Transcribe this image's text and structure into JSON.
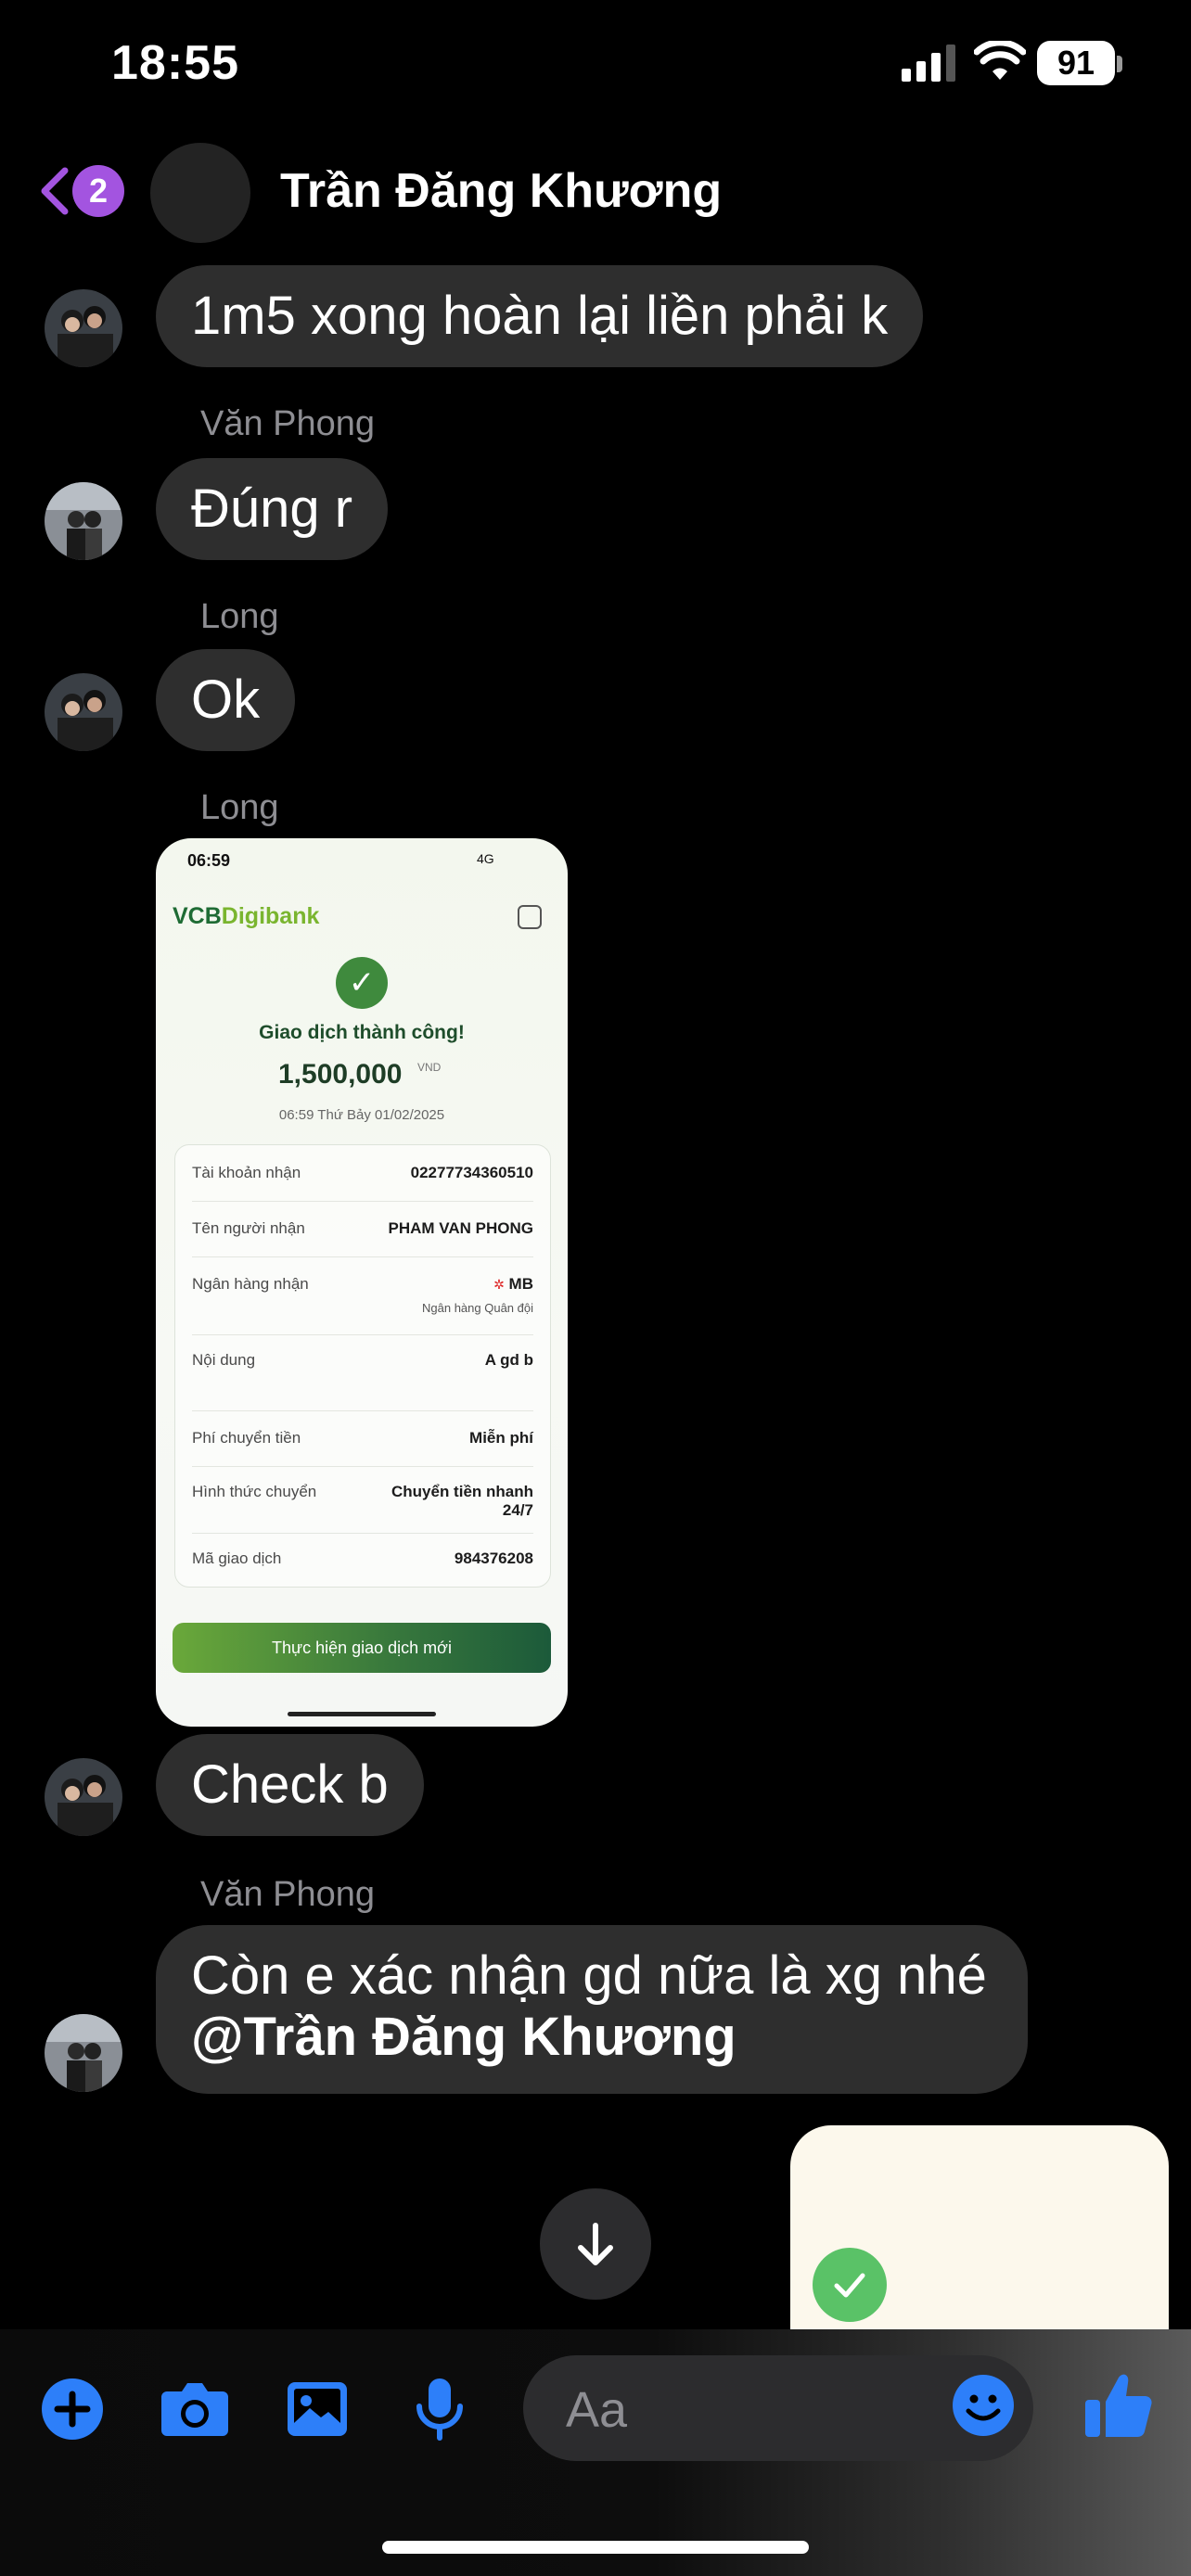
{
  "status_bar": {
    "time": "18:55",
    "battery": "91"
  },
  "header": {
    "back_badge_count": "2",
    "contact_name": "Trần Đăng Khương"
  },
  "messages": [
    {
      "sender": "",
      "text": "1m5 xong hoàn lại liền phải k"
    },
    {
      "sender": "Văn Phong",
      "text": "Đúng r"
    },
    {
      "sender": "Long",
      "text": "Ok"
    },
    {
      "sender": "Long",
      "type": "image"
    },
    {
      "sender": "",
      "text": "Check b"
    },
    {
      "sender": "Văn Phong",
      "text": "Còn e xác nhận gd nữa là xg nhé",
      "mention": "@Trần Đăng Khương"
    }
  ],
  "receipt": {
    "time": "06:59",
    "network": "4G",
    "logo_vcb": "VCB",
    "logo_digi": "Digibank",
    "success": "Giao dịch thành công!",
    "amount": "1,500,000",
    "currency": "VND",
    "datetime": "06:59 Thứ Bảy 01/02/2025",
    "rows": [
      {
        "label": "Tài khoản nhận",
        "value": "02277734360510"
      },
      {
        "label": "Tên người nhận",
        "value": "PHAM VAN PHONG"
      },
      {
        "label": "Ngân hàng nhận",
        "value": "MB",
        "sub": "Ngân hàng Quân đội"
      },
      {
        "label": "Nội dung",
        "value": "A gd b"
      },
      {
        "label": "Phí chuyển tiền",
        "value": "Miễn phí"
      },
      {
        "label": "Hình thức chuyển",
        "value": "Chuyển tiền nhanh",
        "value2": "24/7"
      },
      {
        "label": "Mã giao dịch",
        "value": "984376208"
      }
    ],
    "button": "Thực hiện giao dịch mới"
  },
  "composer": {
    "placeholder": "Aa"
  },
  "colors": {
    "accent": "#a354e0",
    "tool_blue": "#2d7ff9",
    "bubble": "#2e2e2e",
    "vcb_green": "#3f8a3d"
  },
  "icons": [
    "back-chevron-icon",
    "plus-icon",
    "camera-icon",
    "photo-icon",
    "microphone-icon",
    "emoji-icon",
    "thumbs-up-icon",
    "arrow-down-icon",
    "checkmark-icon"
  ]
}
